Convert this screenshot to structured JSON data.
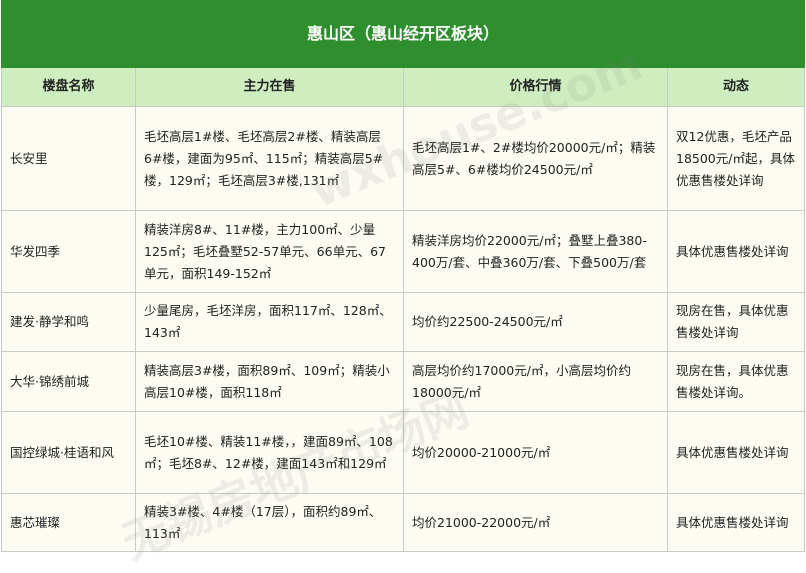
{
  "table": {
    "title": "惠山区（惠山经开区板块）",
    "headers": [
      "楼盘名称",
      "主力在售",
      "价格行情",
      "动态"
    ],
    "rows": [
      {
        "name": "长安里",
        "supply": "毛坯高层1#楼、毛坯高层2#楼、精装高层6#楼，建面为95㎡、115㎡；精装高层5#楼，129㎡；毛坯高层3#楼,131㎡",
        "price": "毛坯高层1#、2#楼均价20000元/㎡；精装高层5#、6#楼均价24500元/㎡",
        "news": "双12优惠，毛坯产品18500元/㎡起，具体优惠售楼处详询"
      },
      {
        "name": "华发四季",
        "supply": "精装洋房8#、11#楼，主力100㎡、少量125㎡；毛坯叠墅52-57单元、66单元、67单元，面积149-152㎡",
        "price": "精装洋房均价22000元/㎡；叠墅上叠380-400万/套、中叠360万/套、下叠500万/套",
        "news": "具体优惠售楼处详询"
      },
      {
        "name": "建发·静学和鸣",
        "supply": "少量尾房，毛坯洋房，面积117㎡、128㎡、143㎡",
        "price": "均价约22500-24500元/㎡",
        "news": "现房在售，具体优惠售楼处详询"
      },
      {
        "name": "大华·锦绣前城",
        "supply": "精装高层3#楼，面积89㎡、109㎡；精装小高层10#楼，面积118㎡",
        "price": "高层均价约17000元/㎡，小高层均价约18000元/㎡",
        "news": "现房在售，具体优惠售楼处详询。"
      },
      {
        "name": "国控绿城·桂语和风",
        "supply": "毛坯10#楼、精装11#楼，，建面89㎡、108㎡；毛坯8#、12#楼，建面143㎡和129㎡",
        "price": "均价20000-21000元/㎡",
        "news": "具体优惠售楼处详询"
      },
      {
        "name": "惠芯璀璨",
        "supply": "精装3#楼、4#楼（17层），面积约89㎡、113㎡",
        "price": "均价21000-22000元/㎡",
        "news": "具体优惠售楼处详询"
      }
    ]
  },
  "watermark": {
    "text_cn": "无锡房地产市场网",
    "text_en": "wxhouse.com"
  }
}
